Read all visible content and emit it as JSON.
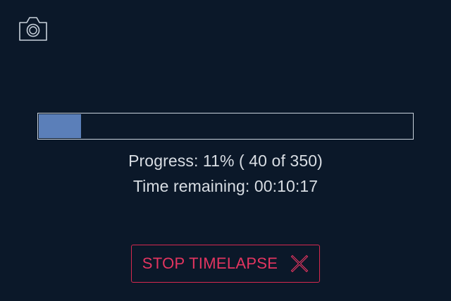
{
  "toolbar": {
    "camera_icon": "camera-icon"
  },
  "progress": {
    "fraction": 0.114,
    "progress_text": "Progress: 11% ( 40 of 350)",
    "time_remaining_text": "Time remaining: 00:10:17"
  },
  "actions": {
    "stop_label": "STOP TIMELAPSE",
    "stop_icon": "close-icon"
  },
  "colors": {
    "background": "#0b1829",
    "bar_fill": "#5b7fb9",
    "bar_border": "#c9d2dc",
    "text": "#d8dde3",
    "danger": "#e33560"
  }
}
